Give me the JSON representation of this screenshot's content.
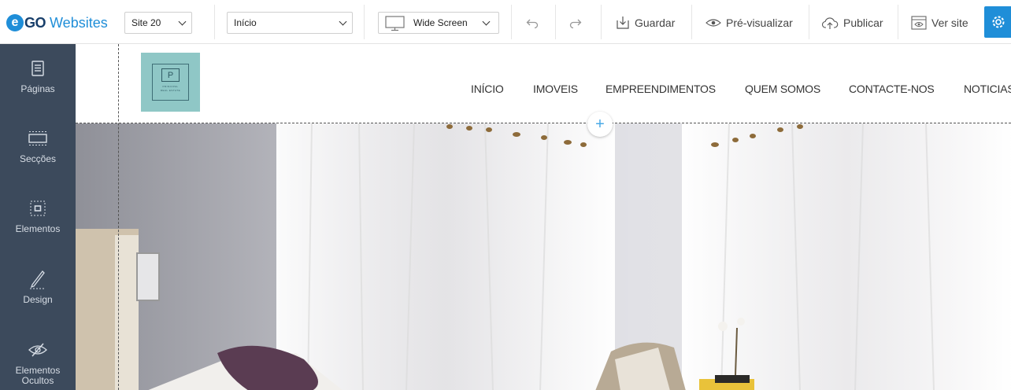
{
  "brand": {
    "letter": "e",
    "go": "GO",
    "websites": "Websites"
  },
  "toolbar": {
    "site_select": "Site 20",
    "page_select": "Início",
    "view_select": "Wide Screen",
    "undo_icon": "undo-icon",
    "redo_icon": "redo-icon",
    "save": "Guardar",
    "preview": "Pré-visualizar",
    "publish": "Publicar",
    "view_site": "Ver site",
    "settings_icon": "gear-icon",
    "accent": "#1f8ed8"
  },
  "sidebar": {
    "bg": "#3c4a5c",
    "items": [
      {
        "label": "Páginas",
        "icon": "pages-icon"
      },
      {
        "label": "Secções",
        "icon": "sections-icon"
      },
      {
        "label": "Elementos",
        "icon": "elements-icon"
      },
      {
        "label": "Design",
        "icon": "pen-icon"
      },
      {
        "label": "Elementos Ocultos",
        "icon": "hidden-eye-icon"
      }
    ]
  },
  "site": {
    "logo_letter": "P",
    "logo_line1": "PRINCIPAL",
    "logo_line2": "REAL ESTATE",
    "logo_color": "#8fc7c6",
    "nav": [
      "INÍCIO",
      "IMOVEIS",
      "EMPREENDIMENTOS",
      "QUEM SOMOS",
      "CONTACTE-NOS",
      "NOTICIAS"
    ]
  },
  "canvas": {
    "add_section_icon": "plus-icon",
    "add_section": "+"
  }
}
